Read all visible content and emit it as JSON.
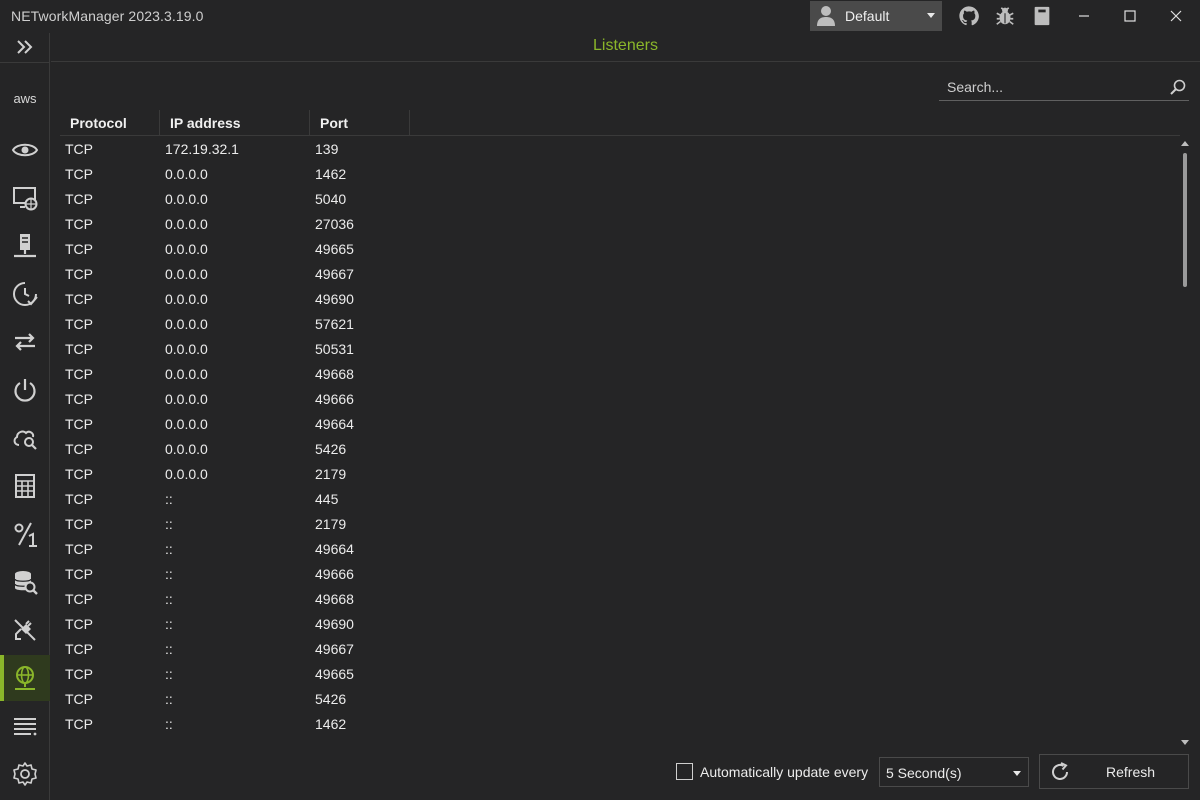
{
  "app": {
    "title": "NETworkManager 2023.3.19.0"
  },
  "profile": {
    "selected": "Default"
  },
  "page": {
    "title": "Listeners"
  },
  "search": {
    "placeholder": "Search..."
  },
  "table": {
    "headers": {
      "protocol": "Protocol",
      "ip": "IP address",
      "port": "Port"
    },
    "rows": [
      [
        "TCP",
        "172.19.32.1",
        "139"
      ],
      [
        "TCP",
        "0.0.0.0",
        "1462"
      ],
      [
        "TCP",
        "0.0.0.0",
        "5040"
      ],
      [
        "TCP",
        "0.0.0.0",
        "27036"
      ],
      [
        "TCP",
        "0.0.0.0",
        "49665"
      ],
      [
        "TCP",
        "0.0.0.0",
        "49667"
      ],
      [
        "TCP",
        "0.0.0.0",
        "49690"
      ],
      [
        "TCP",
        "0.0.0.0",
        "57621"
      ],
      [
        "TCP",
        "0.0.0.0",
        "50531"
      ],
      [
        "TCP",
        "0.0.0.0",
        "49668"
      ],
      [
        "TCP",
        "0.0.0.0",
        "49666"
      ],
      [
        "TCP",
        "0.0.0.0",
        "49664"
      ],
      [
        "TCP",
        "0.0.0.0",
        "5426"
      ],
      [
        "TCP",
        "0.0.0.0",
        "2179"
      ],
      [
        "TCP",
        "::",
        "445"
      ],
      [
        "TCP",
        "::",
        "2179"
      ],
      [
        "TCP",
        "::",
        "49664"
      ],
      [
        "TCP",
        "::",
        "49666"
      ],
      [
        "TCP",
        "::",
        "49668"
      ],
      [
        "TCP",
        "::",
        "49690"
      ],
      [
        "TCP",
        "::",
        "49667"
      ],
      [
        "TCP",
        "::",
        "49665"
      ],
      [
        "TCP",
        "::",
        "5426"
      ],
      [
        "TCP",
        "::",
        "1462"
      ]
    ]
  },
  "bottom": {
    "auto_update_label": "Automatically update every",
    "auto_update_checked": false,
    "interval": "5 Second(s)",
    "refresh_label": "Refresh"
  },
  "sidebar": {
    "aws_label": "aws",
    "icons": [
      "aws-icon",
      "eye-icon",
      "remote-desktop-icon",
      "server-icon",
      "history-check-icon",
      "transfer-arrows-icon",
      "power-icon",
      "cloud-search-icon",
      "calculator-icon",
      "percent-icon",
      "database-search-icon",
      "plug-icon",
      "network-globe-icon",
      "list-icon",
      "gear-icon"
    ],
    "active": "network-globe-icon"
  },
  "colors": {
    "accent": "#8ab62a",
    "background": "#252526",
    "border": "#3a3a3a"
  }
}
